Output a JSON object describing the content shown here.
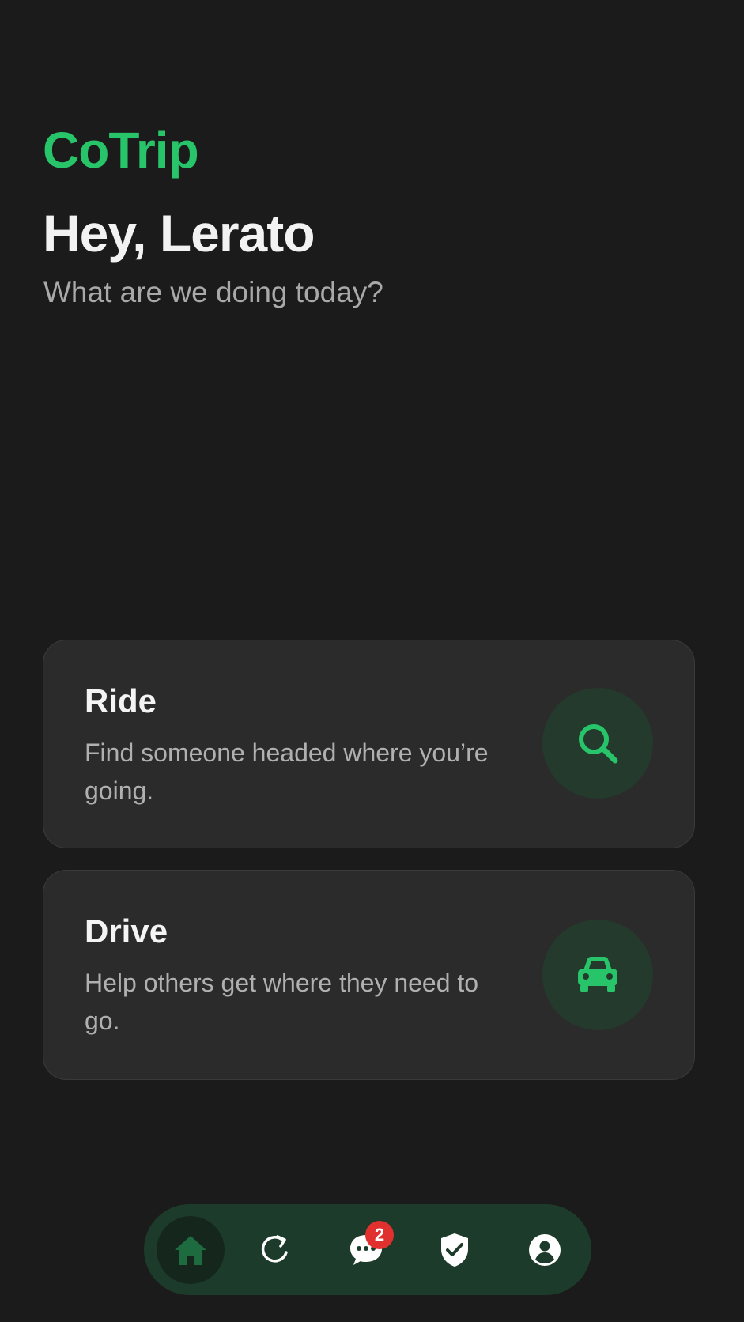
{
  "app": {
    "brand": "CoTrip",
    "greeting": "Hey, Lerato",
    "subtitle": "What are we doing today?"
  },
  "cards": [
    {
      "title": "Ride",
      "description": "Find someone headed where you’re going.",
      "icon": "search-icon"
    },
    {
      "title": "Drive",
      "description": "Help others get where they need to go.",
      "icon": "car-icon"
    }
  ],
  "nav": {
    "items": [
      {
        "name": "home",
        "icon": "home-icon",
        "active": true
      },
      {
        "name": "history",
        "icon": "refresh-icon",
        "active": false
      },
      {
        "name": "messages",
        "icon": "chat-icon",
        "active": false,
        "badge": "2"
      },
      {
        "name": "safety",
        "icon": "shield-check-icon",
        "active": false
      },
      {
        "name": "profile",
        "icon": "user-icon",
        "active": false
      }
    ]
  },
  "colors": {
    "background": "#1b1b1b",
    "accent": "#27c46a",
    "card": "#2b2b2b",
    "nav": "#1d3b2a",
    "badge": "#e0312f"
  }
}
